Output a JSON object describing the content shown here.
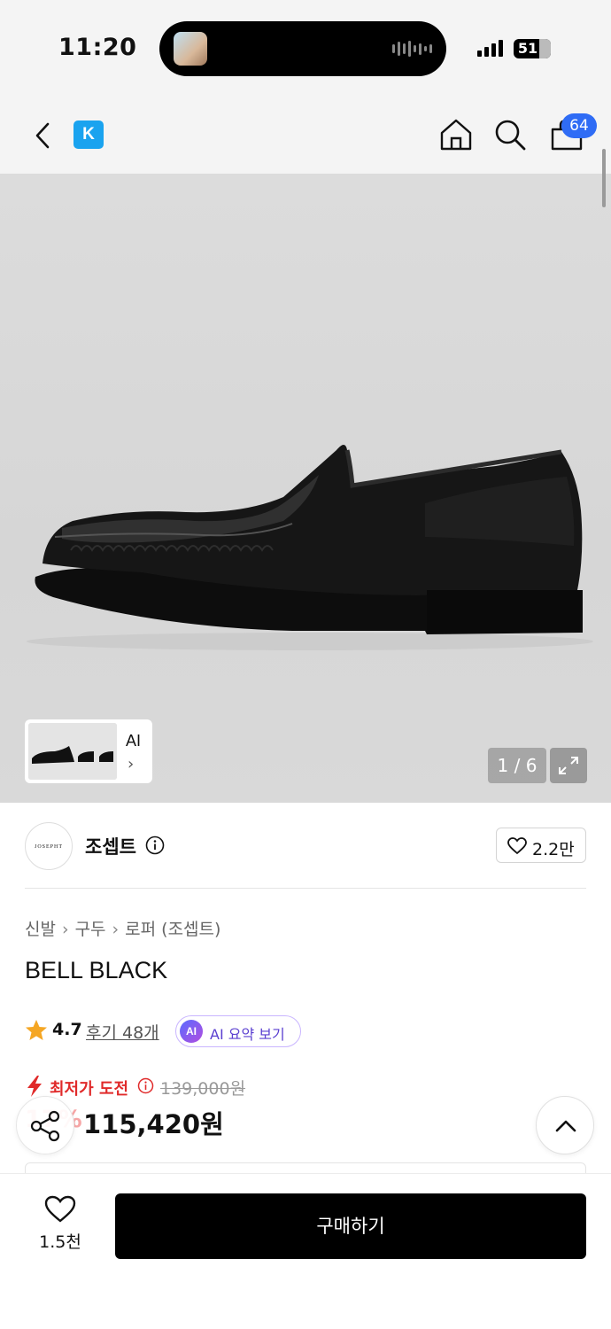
{
  "status_bar": {
    "time": "11:20",
    "battery": "51"
  },
  "nav": {
    "logo_letter": "K",
    "cart_count": "64",
    "icons": [
      "back-icon",
      "home-icon",
      "search-icon",
      "cart-icon"
    ]
  },
  "gallery": {
    "thumbnail_label": "AI",
    "counter": "1 / 6"
  },
  "brand": {
    "name": "조셉트",
    "logo_text": "JOSEPHT",
    "like_count": "2.2만"
  },
  "breadcrumb": [
    "신발",
    "구두",
    "로퍼 (조셉트)"
  ],
  "product": {
    "title": "BELL BLACK",
    "rating": "4.7",
    "reviews": "후기 48개",
    "ai_summary_badge": "AI",
    "ai_summary_label": "AI 요약 보기",
    "deal_label": "최저가 도전",
    "original_price": "139,000원",
    "discount": "17%",
    "sale_price": "115,420원"
  },
  "bottom_bar": {
    "wish_count": "1.5천",
    "buy_label": "구매하기"
  },
  "colors": {
    "accent_blue": "#2f6cf5",
    "deal_red": "#e02a2a",
    "buy_button": "#000000",
    "logo_blue": "#1aa3ef"
  }
}
